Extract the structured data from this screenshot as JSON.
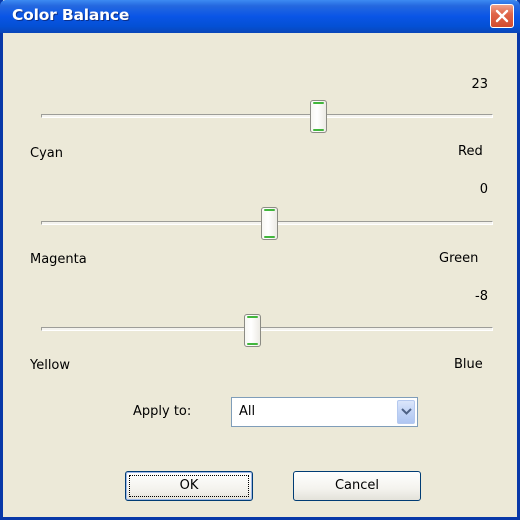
{
  "window": {
    "title": "Color Balance"
  },
  "sliders": [
    {
      "value": "23",
      "left_label": "Cyan",
      "right_label": "Red"
    },
    {
      "value": "0",
      "left_label": "Magenta",
      "right_label": "Green"
    },
    {
      "value": "-8",
      "left_label": "Yellow",
      "right_label": "Blue"
    }
  ],
  "apply_to": {
    "label": "Apply to:",
    "selected": "All"
  },
  "buttons": {
    "ok": "OK",
    "cancel": "Cancel"
  },
  "colors": {
    "titlebar": "#0a55e6",
    "background": "#ece9d8",
    "thumb_accent": "#41b63c",
    "close_button": "#d24a2e"
  }
}
